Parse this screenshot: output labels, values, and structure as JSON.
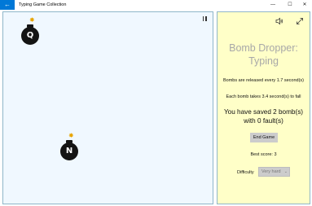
{
  "titlebar": {
    "back_icon": "arrow-left-icon",
    "back_glyph": "←",
    "title": "Typing Game Collection",
    "minimize_glyph": "—",
    "maximize_glyph": "☐",
    "close_glyph": "✕"
  },
  "game": {
    "pause_icon": "pause-icon",
    "bombs": [
      {
        "letter": "Q"
      },
      {
        "letter": "N"
      }
    ]
  },
  "panel": {
    "sound_icon": "speaker-icon",
    "fullscreen_icon": "expand-icon",
    "title": "Bomb Dropper: Typing",
    "release_text": "Bombs are released every 1.7 second(s)",
    "fall_text": "Each bomb takes 3.4 second(s) to fall",
    "saved_text": "You have saved 2 bomb(s) with 0 fault(s)",
    "end_button": "End Game",
    "best_score": "Best score: 3",
    "difficulty_label": "Difficulty",
    "difficulty_value": "Very hard",
    "chevron_glyph": "⌄"
  },
  "colors": {
    "accent": "#0078d7",
    "game_bg": "#f0f8ff",
    "panel_bg": "#ffffc8",
    "border": "#8fb6c9",
    "bomb": "#141414",
    "spark": "#e8a400"
  }
}
